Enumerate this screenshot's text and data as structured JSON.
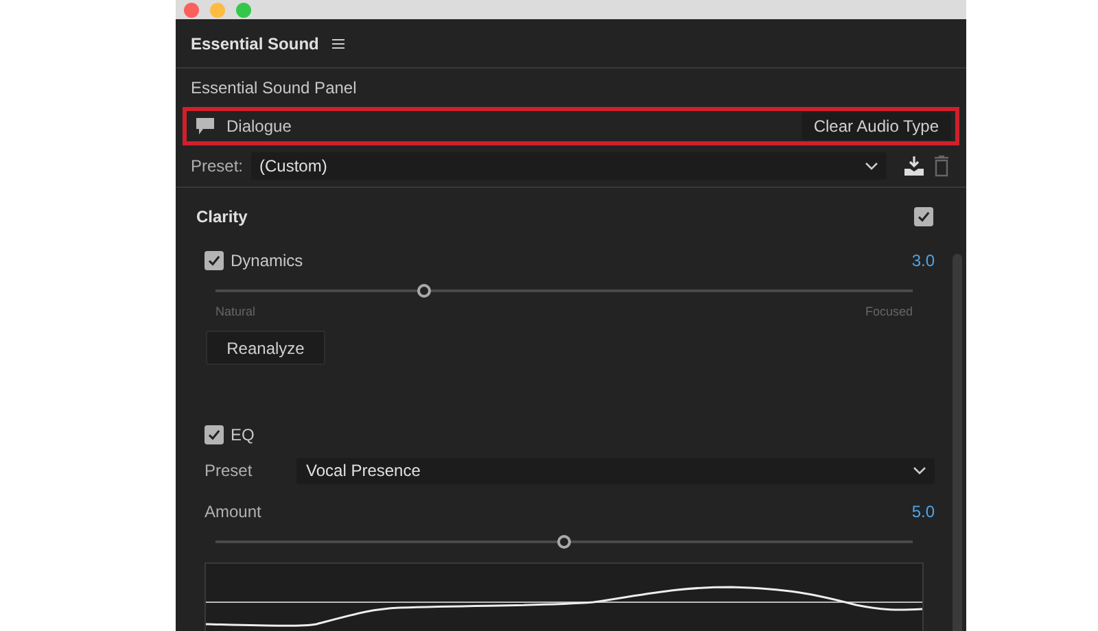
{
  "panel": {
    "title": "Essential Sound",
    "subtitle": "Essential Sound Panel"
  },
  "audio_type": {
    "label": "Dialogue",
    "highlighted": true,
    "clear_button": "Clear Audio Type"
  },
  "preset": {
    "label": "Preset:",
    "value": "(Custom)"
  },
  "clarity": {
    "title": "Clarity",
    "checked": true,
    "dynamics": {
      "label": "Dynamics",
      "checked": true,
      "value": "3.0",
      "level": 0.3,
      "min_label": "Natural",
      "max_label": "Focused",
      "button": "Reanalyze"
    },
    "eq": {
      "label": "EQ",
      "checked": true,
      "preset_label": "Preset",
      "preset_value": "Vocal Presence",
      "amount_label": "Amount",
      "amount_value": "5.0",
      "level": 0.5
    }
  }
}
